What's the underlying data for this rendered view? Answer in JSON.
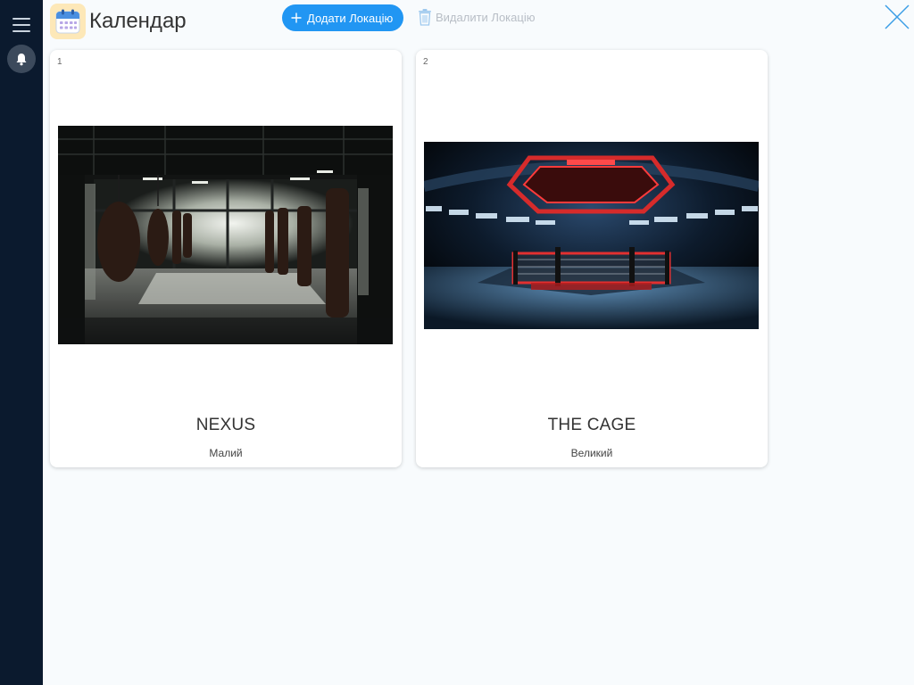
{
  "header": {
    "title": "Календар",
    "add_label": "Додати Локацію",
    "delete_label": "Видалити Локацію"
  },
  "colors": {
    "sidebar": "#0b1a2e",
    "accent": "#2196f3",
    "close": "#3b9ee6"
  },
  "locations": [
    {
      "index": "1",
      "name": "NEXUS",
      "size": "Малий"
    },
    {
      "index": "2",
      "name": "THE CAGE",
      "size": "Великий"
    }
  ]
}
